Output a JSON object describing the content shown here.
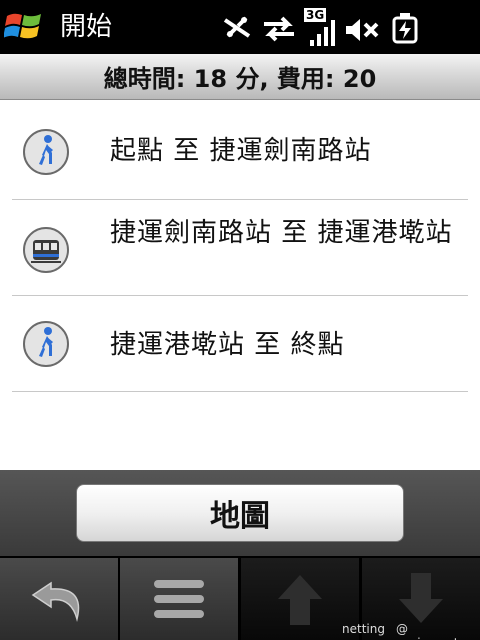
{
  "statusbar": {
    "title": "開始",
    "network_label": "3G",
    "icons": [
      "windows-start-icon",
      "no-signal-icon",
      "data-transfer-icon",
      "3g-signal-icon",
      "volume-muted-icon",
      "battery-charging-icon"
    ]
  },
  "summary": {
    "text": "總時間: 18 分, 費用: 20"
  },
  "routes": [
    {
      "icon": "walk-icon",
      "text": "起點 至 捷運劍南路站"
    },
    {
      "icon": "metro-train-icon",
      "text": "捷運劍南路站 至 捷運港墘站"
    },
    {
      "icon": "walk-icon",
      "text": "捷運港墘站 至 終點"
    }
  ],
  "map_button": {
    "label": "地圖"
  },
  "softkeys": [
    {
      "icon": "back-arrow-icon"
    },
    {
      "icon": "menu-icon"
    },
    {
      "icon": "arrow-up-icon"
    },
    {
      "icon": "arrow-down-icon"
    }
  ],
  "watermark": {
    "left": "netting",
    "right": "@ sogi.com.tw"
  },
  "colors": {
    "icon_blue": "#2f6fd6",
    "header_gray": "#cfcfcf"
  }
}
